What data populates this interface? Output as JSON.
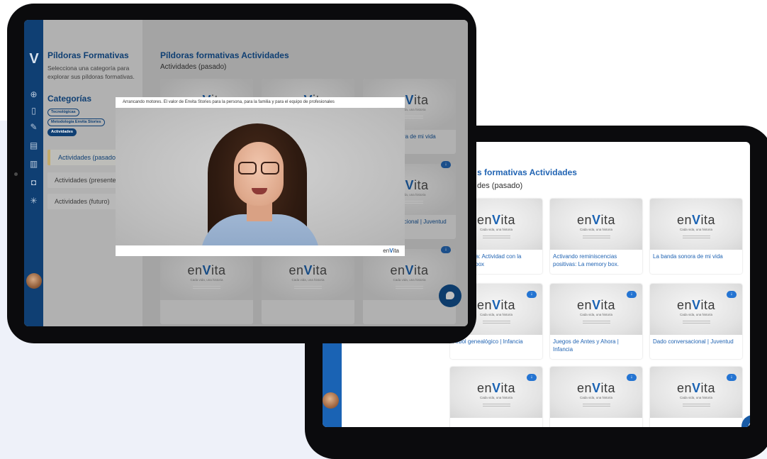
{
  "colors": {
    "brand_blue": "#1a63b4",
    "dark_blue": "#0f3f73",
    "accent_gold": "#c2aa6a"
  },
  "back_tablet": {
    "title": "s formativas Actividades",
    "subtitle": "des (pasado)",
    "cards": [
      {
        "caption": "de mi vida: Actividad con la memory box",
        "download": false
      },
      {
        "caption": "Activando reminiscencias positivas: La memory box.",
        "download": false
      },
      {
        "caption": "La banda sonora de mi vida",
        "download": false
      },
      {
        "caption": "Árbol genealógico | Infancia",
        "download": true
      },
      {
        "caption": "Juegos de Antes y Ahora | Infancia",
        "download": true
      },
      {
        "caption": "Dado conversacional | Juventud",
        "download": true
      },
      {
        "caption": "",
        "download": true
      },
      {
        "caption": "",
        "download": true
      },
      {
        "caption": "",
        "download": true
      }
    ]
  },
  "thumbnail": {
    "brand_pre": "en",
    "brand_v": "V",
    "brand_post": "ita",
    "tagline": "Cada vida, una historia"
  },
  "front_tablet": {
    "sidebar_icons": [
      "plus-circle-icon",
      "document-icon",
      "pencil-icon",
      "book-icon",
      "library-icon",
      "camera-icon",
      "network-icon"
    ],
    "panel": {
      "title": "Píldoras Formativas",
      "description": "Selecciona una categoría para explorar sus píldoras formativas.",
      "categories_heading": "Categorías",
      "chips": [
        "Tecnológicas",
        "Metodología Envita Stories",
        "Actividades"
      ],
      "nav": [
        "Actividades (pasado)",
        "Actividades (presente)",
        "Actividades (futuro)"
      ]
    },
    "main": {
      "title": "Píldoras formativas Actividades",
      "subtitle": "Actividades (pasado)",
      "cards": [
        {
          "caption": "",
          "download": false
        },
        {
          "caption": "",
          "download": false
        },
        {
          "caption": "La banda sonora de mi vida",
          "download": false
        },
        {
          "caption": "",
          "download": true
        },
        {
          "caption": "",
          "download": true
        },
        {
          "caption": "Dado conversacional | Juventud",
          "download": true
        },
        {
          "caption": "",
          "download": true
        },
        {
          "caption": "",
          "download": true
        },
        {
          "caption": "",
          "download": true
        }
      ]
    },
    "video": {
      "title": "Arrancando motores. El valor de Envita Stories para la persona, para la familia y para el equipo de profesionales",
      "brand_pre": "en",
      "brand_v": "V",
      "brand_post": "ita"
    }
  }
}
